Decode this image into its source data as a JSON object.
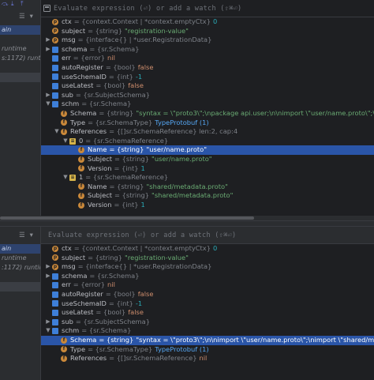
{
  "top": {
    "toolbar_icons": [
      "step-over-icon",
      "step-into-icon",
      "step-out-icon",
      "run-to-cursor-icon",
      "evaluate-icon"
    ],
    "eval_placeholder": "Evaluate expression (⏎) or add a watch (⇧⌘⏎)",
    "frames": [
      {
        "text": "ain",
        "style": "sel"
      },
      {
        "text": "",
        "style": ""
      },
      {
        "text": "runtime",
        "style": ""
      },
      {
        "text": "s:1172) runtim",
        "style": ""
      },
      {
        "text": "",
        "style": ""
      },
      {
        "text": "",
        "style": "dim"
      }
    ],
    "rows": [
      {
        "indent": 0,
        "arrow": "",
        "icon": "p",
        "name": "ctx",
        "type": "= {context.Context | *context.emptyCtx}",
        "value": "0",
        "vclass": "num"
      },
      {
        "indent": 0,
        "arrow": "",
        "icon": "p",
        "name": "subject",
        "type": "= {string}",
        "value": "\"registration-value\"",
        "vclass": ""
      },
      {
        "indent": 0,
        "arrow": ">",
        "icon": "p",
        "name": "msg",
        "type": "= {interface{} | *user.RegistrationData}",
        "value": "",
        "vclass": ""
      },
      {
        "indent": 0,
        "arrow": ">",
        "icon": "sq",
        "name": "schema",
        "type": "= {sr.Schema}",
        "value": "",
        "vclass": ""
      },
      {
        "indent": 0,
        "arrow": "",
        "icon": "sq",
        "name": "err",
        "type": "= {error}",
        "value": "nil",
        "vclass": "kw"
      },
      {
        "indent": 0,
        "arrow": "",
        "icon": "sq",
        "name": "autoRegister",
        "type": "= {bool}",
        "value": "false",
        "vclass": "kw"
      },
      {
        "indent": 0,
        "arrow": "",
        "icon": "sq",
        "name": "useSchemaID",
        "type": "= {int}",
        "value": "-1",
        "vclass": "num"
      },
      {
        "indent": 0,
        "arrow": "",
        "icon": "sq",
        "name": "useLatest",
        "type": "= {bool}",
        "value": "false",
        "vclass": "kw"
      },
      {
        "indent": 0,
        "arrow": ">",
        "icon": "sq",
        "name": "sub",
        "type": "= {sr.SubjectSchema}",
        "value": "",
        "vclass": ""
      },
      {
        "indent": 0,
        "arrow": "v",
        "icon": "sq",
        "name": "schm",
        "type": "= {sr.Schema}",
        "value": "",
        "vclass": ""
      },
      {
        "indent": 1,
        "arrow": "",
        "icon": "f",
        "name": "Schema",
        "type": "= {string}",
        "value": "\"syntax = \\\"proto3\\\";\\npackage api.user;\\n\\nimport \\\"user/name.proto\\\";\\nimport \\\"shared/metadata",
        "vclass": ""
      },
      {
        "indent": 1,
        "arrow": "",
        "icon": "f",
        "name": "Type",
        "type": "= {sr.SchemaType}",
        "value": "TypeProtobuf (1)",
        "vclass": "link"
      },
      {
        "indent": 1,
        "arrow": "v",
        "icon": "f",
        "name": "References",
        "type": "= {[]sr.SchemaReference} len:2, cap:4",
        "value": "",
        "vclass": ""
      },
      {
        "indent": 2,
        "arrow": "v",
        "icon": "list",
        "name": "0",
        "type": "= {sr.SchemaReference}",
        "value": "",
        "vclass": ""
      },
      {
        "indent": 3,
        "arrow": "",
        "icon": "f",
        "name": "Name",
        "type": "= {string}",
        "value": "\"user/name.proto\"",
        "vclass": "",
        "selected": true
      },
      {
        "indent": 3,
        "arrow": "",
        "icon": "f",
        "name": "Subject",
        "type": "= {string}",
        "value": "\"user/name.proto\"",
        "vclass": ""
      },
      {
        "indent": 3,
        "arrow": "",
        "icon": "f",
        "name": "Version",
        "type": "= {int}",
        "value": "1",
        "vclass": "num"
      },
      {
        "indent": 2,
        "arrow": "v",
        "icon": "list",
        "name": "1",
        "type": "= {sr.SchemaReference}",
        "value": "",
        "vclass": ""
      },
      {
        "indent": 3,
        "arrow": "",
        "icon": "f",
        "name": "Name",
        "type": "= {string}",
        "value": "\"shared/metadata.proto\"",
        "vclass": ""
      },
      {
        "indent": 3,
        "arrow": "",
        "icon": "f",
        "name": "Subject",
        "type": "= {string}",
        "value": "\"shared/metadata.proto\"",
        "vclass": ""
      },
      {
        "indent": 3,
        "arrow": "",
        "icon": "f",
        "name": "Version",
        "type": "= {int}",
        "value": "1",
        "vclass": "num"
      }
    ]
  },
  "bottom": {
    "eval_placeholder": "Evaluate expression (⏎) or add a watch (⇧⌘⏎)",
    "frames": [
      {
        "text": "ain",
        "style": "sel"
      },
      {
        "text": "runtime",
        "style": ""
      },
      {
        "text": ":1172) runtim",
        "style": ""
      },
      {
        "text": "",
        "style": ""
      },
      {
        "text": "",
        "style": "dim"
      }
    ],
    "rows": [
      {
        "indent": 0,
        "arrow": "",
        "icon": "p",
        "name": "ctx",
        "type": "= {context.Context | *context.emptyCtx}",
        "value": "0",
        "vclass": "num"
      },
      {
        "indent": 0,
        "arrow": "",
        "icon": "p",
        "name": "subject",
        "type": "= {string}",
        "value": "\"registration-value\"",
        "vclass": ""
      },
      {
        "indent": 0,
        "arrow": ">",
        "icon": "p",
        "name": "msg",
        "type": "= {interface{} | *user.RegistrationData}",
        "value": "",
        "vclass": ""
      },
      {
        "indent": 0,
        "arrow": ">",
        "icon": "sq",
        "name": "schema",
        "type": "= {sr.Schema}",
        "value": "",
        "vclass": ""
      },
      {
        "indent": 0,
        "arrow": "",
        "icon": "sq",
        "name": "err",
        "type": "= {error}",
        "value": "nil",
        "vclass": "kw"
      },
      {
        "indent": 0,
        "arrow": "",
        "icon": "sq",
        "name": "autoRegister",
        "type": "= {bool}",
        "value": "false",
        "vclass": "kw"
      },
      {
        "indent": 0,
        "arrow": "",
        "icon": "sq",
        "name": "useSchemaID",
        "type": "= {int}",
        "value": "-1",
        "vclass": "num"
      },
      {
        "indent": 0,
        "arrow": "",
        "icon": "sq",
        "name": "useLatest",
        "type": "= {bool}",
        "value": "false",
        "vclass": "kw"
      },
      {
        "indent": 0,
        "arrow": ">",
        "icon": "sq",
        "name": "sub",
        "type": "= {sr.SubjectSchema}",
        "value": "",
        "vclass": ""
      },
      {
        "indent": 0,
        "arrow": "v",
        "icon": "sq",
        "name": "schm",
        "type": "= {sr.Schema}",
        "value": "",
        "vclass": ""
      },
      {
        "indent": 1,
        "arrow": "",
        "icon": "f",
        "name": "Schema",
        "type": "= {string}",
        "value": "\"syntax = \\\"proto3\\\";\\n\\nimport \\\"user/name.proto\\\";\\nimport \\\"shared/metadata.proto\\\";\\npackage",
        "vclass": "",
        "selected": true
      },
      {
        "indent": 1,
        "arrow": "",
        "icon": "f",
        "name": "Type",
        "type": "= {sr.SchemaType}",
        "value": "TypeProtobuf (1)",
        "vclass": "link"
      },
      {
        "indent": 1,
        "arrow": "",
        "icon": "f",
        "name": "References",
        "type": "= {[]sr.SchemaReference}",
        "value": "nil",
        "vclass": "kw"
      }
    ]
  }
}
